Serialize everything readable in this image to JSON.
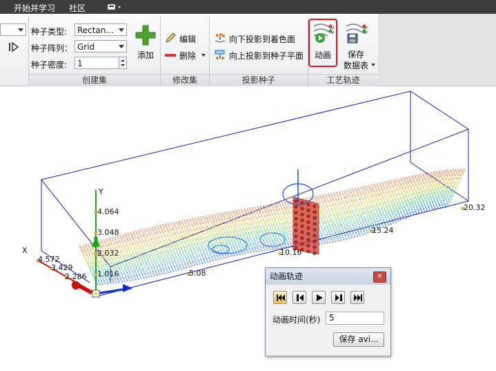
{
  "menu": {
    "tabs": [
      "开始并学习",
      "社区"
    ]
  },
  "create_set": {
    "label": "创建集",
    "seed_type_label": "种子类型:",
    "seed_type_value": "Rectan...",
    "seed_array_label": "种子阵列：",
    "seed_array_value": "Grid",
    "seed_density_label": "种子密度:",
    "seed_density_value": "1",
    "add_label": "添加"
  },
  "modify_set": {
    "label": "修改集",
    "edit_label": "编辑",
    "delete_label": "删除"
  },
  "project_seeds": {
    "label": "投影种子",
    "down_label": "向下投影到着色面",
    "up_label": "向上投影到种子平面"
  },
  "trajectory": {
    "label": "工艺轨迹",
    "animate_label": "动画",
    "save_label_1": "保存",
    "save_label_2": "数据表"
  },
  "viewport": {
    "axis_y": "Y",
    "axis_x": "X",
    "y_ticks": [
      "4.064",
      "3.048",
      "2.032",
      "1.016"
    ],
    "x_ticks": [
      "4.572",
      "3.429",
      "2.286"
    ],
    "z_ticks": [
      "5.08",
      "10.16",
      "15.24",
      "20.32"
    ],
    "colors": {
      "box": "#1a1aa8",
      "seed_plane": "#cc3322",
      "axis_x": "#cc1111",
      "axis_y": "#11aa11",
      "axis_z": "#1133cc"
    }
  },
  "dialog": {
    "title": "动画轨迹",
    "close_icon": "close-icon",
    "time_label": "动画时间(秒)",
    "time_value": "5",
    "save_button": "保存 avi..."
  }
}
